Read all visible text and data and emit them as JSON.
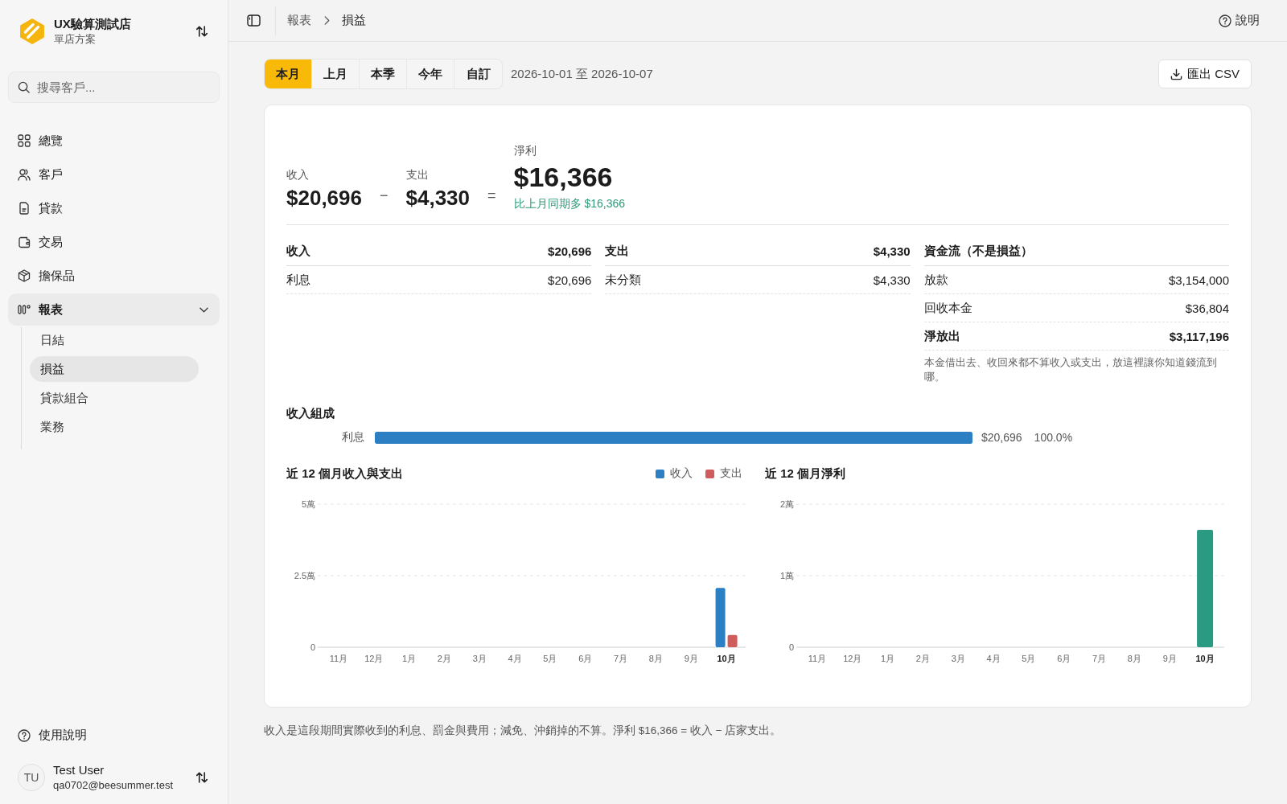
{
  "sidebar": {
    "store": {
      "name": "UX驗算測試店",
      "plan": "單店方案"
    },
    "search": {
      "placeholder": "搜尋客戶..."
    },
    "nav": [
      {
        "label": "總覽",
        "selected": false
      },
      {
        "label": "客戶",
        "selected": false
      },
      {
        "label": "貸款",
        "selected": false
      },
      {
        "label": "交易",
        "selected": false
      },
      {
        "label": "擔保品",
        "selected": false
      },
      {
        "label": "報表",
        "selected": true,
        "expanded": true,
        "children": [
          {
            "label": "日結",
            "selected": false
          },
          {
            "label": "損益",
            "selected": true
          },
          {
            "label": "貸款組合",
            "selected": false
          },
          {
            "label": "業務",
            "selected": false
          }
        ]
      }
    ],
    "help": "使用說明",
    "user": {
      "initials": "TU",
      "name": "Test User",
      "email": "qa0702@beesummer.test"
    }
  },
  "topbar": {
    "breadcrumb": [
      "報表",
      "損益"
    ],
    "help": "說明"
  },
  "toolbar": {
    "periods": [
      {
        "label": "本月",
        "selected": true
      },
      {
        "label": "上月",
        "selected": false
      },
      {
        "label": "本季",
        "selected": false
      },
      {
        "label": "今年",
        "selected": false
      },
      {
        "label": "自訂",
        "selected": false
      }
    ],
    "date_range": "2026-10-01 至 2026-10-07",
    "export": "匯出 CSV"
  },
  "summary": {
    "income": {
      "label": "收入",
      "value": "$20,696"
    },
    "minus": "−",
    "expense": {
      "label": "支出",
      "value": "$4,330"
    },
    "equals": "=",
    "net": {
      "label": "淨利",
      "value": "$16,366",
      "comparison": "比上月同期多 $16,366"
    }
  },
  "breakdown": [
    {
      "title": "收入",
      "total": "$20,696",
      "rows": [
        {
          "label": "利息",
          "value": "$20,696"
        }
      ]
    },
    {
      "title": "支出",
      "total": "$4,330",
      "rows": [
        {
          "label": "未分類",
          "value": "$4,330"
        }
      ]
    }
  ],
  "cash_flow": {
    "title": "資金流（不是損益）",
    "rows": [
      {
        "label": "放款",
        "value": "$3,154,000",
        "kind": "normal"
      },
      {
        "label": "回收本金",
        "value": "$36,804",
        "kind": "normal"
      },
      {
        "label": "淨放出",
        "value": "$3,117,196",
        "kind": "total"
      }
    ],
    "note": "本金借出去、收回來都不算收入或支出，放這裡讓你知道錢流到哪。"
  },
  "income_composition": {
    "title": "收入組成",
    "items": [
      {
        "label": "利息",
        "level": 1.0,
        "amount": "$20,696",
        "share": "100.0%"
      }
    ]
  },
  "charts": [
    {
      "emphasize_last_category": true,
      "chart_data": {
        "type": "bar",
        "title": "近 12 個月收入與支出",
        "categories": [
          "11月",
          "12月",
          "1月",
          "2月",
          "3月",
          "4月",
          "5月",
          "6月",
          "7月",
          "8月",
          "9月",
          "10月"
        ],
        "series": [
          {
            "name": "收入",
            "color": "#2b7fc2",
            "values": [
              0,
              0,
              0,
              0,
              0,
              0,
              0,
              0,
              0,
              0,
              0,
              2.07
            ]
          },
          {
            "name": "支出",
            "color": "#d05c5c",
            "values": [
              0,
              0,
              0,
              0,
              0,
              0,
              0,
              0,
              0,
              0,
              0,
              0.43
            ]
          }
        ],
        "ylim": [
          0,
          5
        ],
        "yticks": [
          {
            "value": 0,
            "label": "0"
          },
          {
            "value": 2.5,
            "label": "2.5萬"
          },
          {
            "value": 5,
            "label": "5萬"
          }
        ]
      }
    },
    {
      "emphasize_last_category": true,
      "chart_data": {
        "type": "bar",
        "title": "近 12 個月淨利",
        "categories": [
          "11月",
          "12月",
          "1月",
          "2月",
          "3月",
          "4月",
          "5月",
          "6月",
          "7月",
          "8月",
          "9月",
          "10月"
        ],
        "values": [
          0,
          0,
          0,
          0,
          0,
          0,
          0,
          0,
          0,
          0,
          0,
          1.64
        ],
        "ylim": [
          0,
          2
        ],
        "yticks": [
          {
            "value": 0,
            "label": "0"
          },
          {
            "value": 1,
            "label": "1萬"
          },
          {
            "value": 2,
            "label": "2萬"
          }
        ]
      }
    }
  ],
  "footnote": "收入是這段期間實際收到的利息、罰金與費用；減免、沖銷掉的不算。淨利 $16,366 = 收入 − 店家支出。"
}
